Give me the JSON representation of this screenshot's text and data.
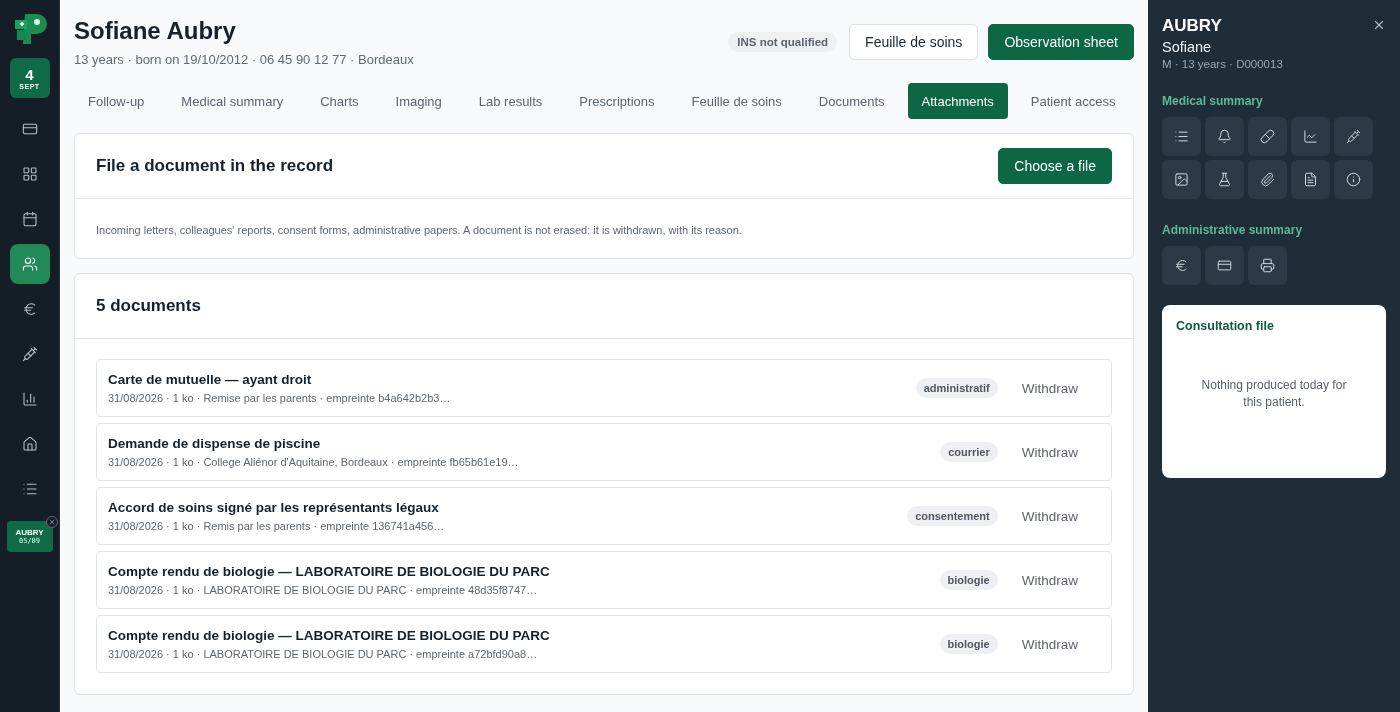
{
  "rail": {
    "date": {
      "day": "4",
      "month": "SEPT"
    },
    "nav": [
      {
        "selected": false
      },
      {
        "selected": false
      },
      {
        "selected": false
      },
      {
        "selected": true
      },
      {
        "selected": false
      },
      {
        "selected": false
      },
      {
        "selected": false
      },
      {
        "selected": false
      },
      {
        "selected": false
      }
    ],
    "open_patient": {
      "name": "AUBRY",
      "date": "05/09"
    }
  },
  "header": {
    "name": "Sofiane Aubry",
    "details": "13 years · born on 19/10/2012 · 06 45 90 12 77 · Bordeaux",
    "badge": "INS not qualified",
    "buttons": [
      {
        "label": "Feuille de soins",
        "kind": "secondary"
      },
      {
        "label": "Observation sheet",
        "kind": "primary"
      }
    ]
  },
  "tabs": [
    {
      "label": "Follow-up",
      "selected": false
    },
    {
      "label": "Medical summary",
      "selected": false
    },
    {
      "label": "Charts",
      "selected": false
    },
    {
      "label": "Imaging",
      "selected": false
    },
    {
      "label": "Lab results",
      "selected": false
    },
    {
      "label": "Prescriptions",
      "selected": false
    },
    {
      "label": "Feuille de soins",
      "selected": false
    },
    {
      "label": "Documents",
      "selected": false
    },
    {
      "label": "Attachments",
      "selected": true
    },
    {
      "label": "Patient access",
      "selected": false
    }
  ],
  "file_card": {
    "title": "File a document in the record",
    "button": "Choose a file",
    "note": "Incoming letters, colleagues' reports, consent forms, administrative papers. A document is not erased: it is withdrawn, with its reason."
  },
  "documents": {
    "title": "5 documents",
    "items": [
      {
        "title": "Carte de mutuelle — ayant droit",
        "meta": "31/08/2026 · 1 ko · Remise par les parents · empreinte b4a642b2b3…",
        "tag": "administratif",
        "action": "Withdraw"
      },
      {
        "title": "Demande de dispense de piscine",
        "meta": "31/08/2026 · 1 ko · College Aliénor d'Aquitaine, Bordeaux · empreinte fb65b61e19…",
        "tag": "courrier",
        "action": "Withdraw"
      },
      {
        "title": "Accord de soins signé par les représentants légaux",
        "meta": "31/08/2026 · 1 ko · Remis par les parents · empreinte 136741a456…",
        "tag": "consentement",
        "action": "Withdraw"
      },
      {
        "title": "Compte rendu de biologie — LABORATOIRE DE BIOLOGIE DU PARC",
        "meta": "31/08/2026 · 1 ko · LABORATOIRE DE BIOLOGIE DU PARC · empreinte 48d35f8747…",
        "tag": "biologie",
        "action": "Withdraw"
      },
      {
        "title": "Compte rendu de biologie — LABORATOIRE DE BIOLOGIE DU PARC",
        "meta": "31/08/2026 · 1 ko · LABORATOIRE DE BIOLOGIE DU PARC · empreinte a72bfd90a8…",
        "tag": "biologie",
        "action": "Withdraw"
      }
    ]
  },
  "panel": {
    "surname": "AUBRY",
    "first_name": "Sofiane",
    "details": "M · 13 years · D000013",
    "medical_title": "Medical summary",
    "admin_title": "Administrative summary",
    "consultation": {
      "title": "Consultation file",
      "empty": "Nothing produced today for this patient."
    }
  }
}
